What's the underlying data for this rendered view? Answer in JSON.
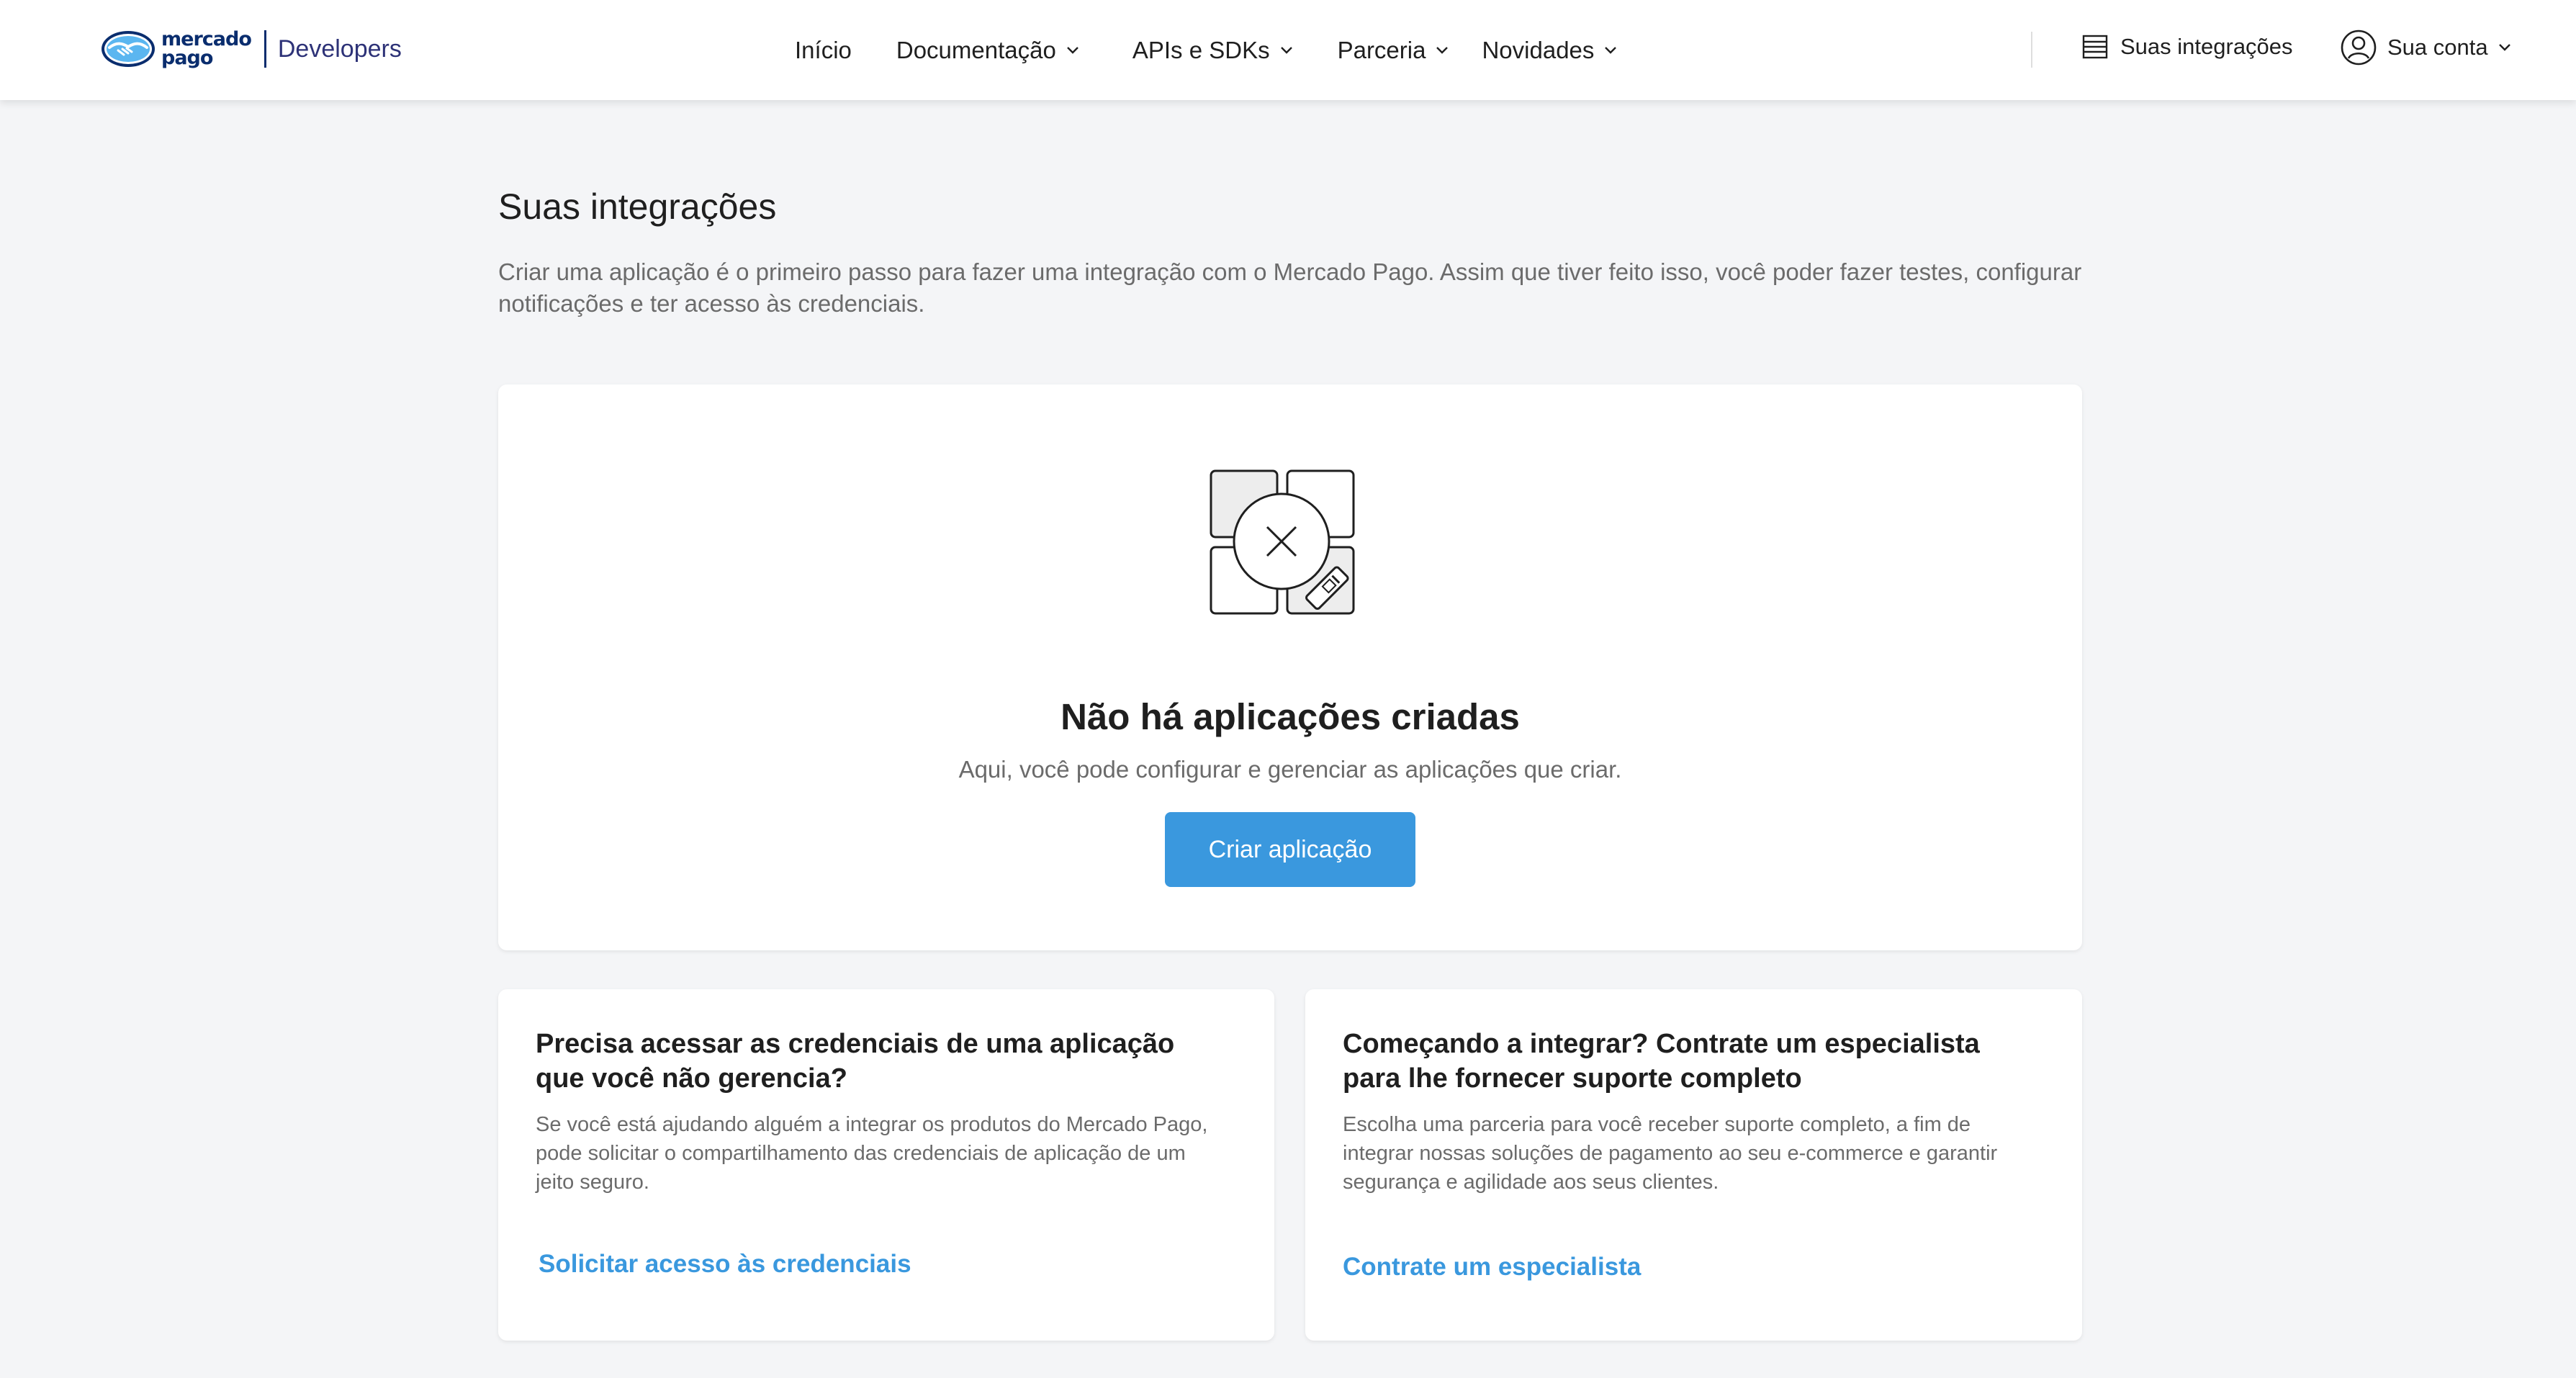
{
  "header": {
    "brand": {
      "line1": "mercado",
      "line2": "pago",
      "product": "Developers"
    },
    "nav": [
      {
        "label": "Início"
      },
      {
        "label": "Documentação"
      },
      {
        "label": "APIs e SDKs"
      },
      {
        "label": "Parceria"
      },
      {
        "label": "Novidades"
      }
    ],
    "integrations_label": "Suas integrações",
    "account_label": "Sua conta"
  },
  "main": {
    "title": "Suas integrações",
    "description": "Criar uma aplicação é o primeiro passo para fazer uma integração com o Mercado Pago. Assim que tiver feito isso, você poder fazer testes, configurar notificações e ter acesso às credenciais.",
    "empty_state": {
      "title": "Não há aplicações criadas",
      "subtitle": "Aqui, você pode configurar e gerenciar as aplicações que criar.",
      "button": "Criar aplicação"
    },
    "cards": [
      {
        "title": "Precisa acessar as credenciais de uma aplicação que você não gerencia?",
        "body": "Se você está ajudando alguém a integrar os produtos do Mercado Pago, pode solicitar o compartilhamento das credenciais de aplicação de um jeito seguro.",
        "link": "Solicitar acesso às credenciais"
      },
      {
        "title": "Começando a integrar? Contrate um especialista para lhe fornecer suporte completo",
        "body": "Escolha uma parceria para você receber suporte completo, a fim de integrar nossas soluções de pagamento ao seu e-commerce e garantir segurança e agilidade aos seus clientes.",
        "link": "Contrate um especialista"
      }
    ]
  },
  "colors": {
    "accent": "#3a98de",
    "brand_navy": "#0a2d6e",
    "background": "#f4f5f7",
    "muted_text": "#6b6b6b"
  },
  "icons": [
    "mercado-pago-logo",
    "chevron-down-icon",
    "list-icon",
    "user-circle-icon",
    "search-empty-illustration"
  ]
}
